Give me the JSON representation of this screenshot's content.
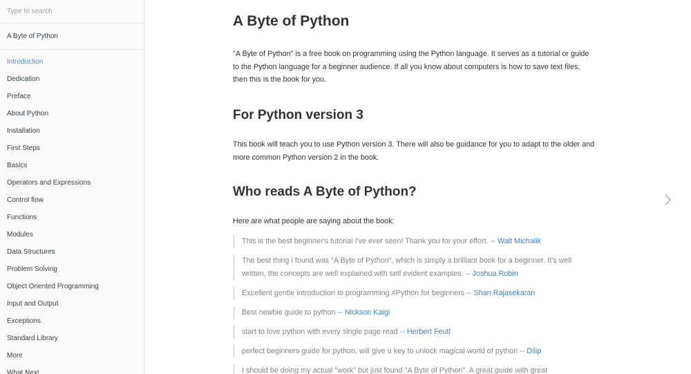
{
  "sidebar": {
    "search_placeholder": "Type to search",
    "book_title": "A Byte of Python",
    "items": [
      {
        "label": "Introduction",
        "active": true
      },
      {
        "label": "Dedication"
      },
      {
        "label": "Preface"
      },
      {
        "label": "About Python"
      },
      {
        "label": "Installation"
      },
      {
        "label": "First Steps"
      },
      {
        "label": "Basics"
      },
      {
        "label": "Operators and Expressions"
      },
      {
        "label": "Control flow"
      },
      {
        "label": "Functions"
      },
      {
        "label": "Modules"
      },
      {
        "label": "Data Structures"
      },
      {
        "label": "Problem Solving"
      },
      {
        "label": "Object Oriented Programming"
      },
      {
        "label": "Input and Output"
      },
      {
        "label": "Exceptions"
      },
      {
        "label": "Standard Library"
      },
      {
        "label": "More"
      },
      {
        "label": "What Next"
      }
    ]
  },
  "main": {
    "title": "A Byte of Python",
    "intro": "\"A Byte of Python\" is a free book on programming using the Python language. It serves as a tutorial or guide to the Python language for a beginner audience. If all you know about computers is how to save text files, then this is the book for you.",
    "section1": {
      "heading": "For Python version 3",
      "text": "This book will teach you to use Python version 3. There will also be guidance for you to adapt to the older and more common Python version 2 in the book."
    },
    "section2": {
      "heading": "Who reads A Byte of Python?",
      "text": "Here are what people are saying about the book:"
    },
    "quotes": [
      {
        "text": "This is the best beginner's tutorial I've ever seen! Thank you for your effort. -- ",
        "author": "Walt Michalik"
      },
      {
        "text": "The best thing i found was \"A Byte of Python\", which is simply a brilliant book for a beginner. It's well written, the concepts are well explained with self evident examples. -- ",
        "author": "Joshua Robin"
      },
      {
        "text": "Excellent gentle introduction to programming #Python for beginners -- ",
        "author": "Shan Rajasekaran"
      },
      {
        "text": "Best newbie guide to python -- ",
        "author": "Nickson Kaigi"
      },
      {
        "text": "start to love python with every single page read -- ",
        "author": "Herbert Feutl"
      },
      {
        "text": "perfect beginners guide for python, will give u key to unlock magical world of python -- ",
        "author": "Dilip"
      },
      {
        "text": "I should be doing my actual \"work\" but just found \"A Byte of Python\". A great guide with great",
        "author": ""
      }
    ]
  },
  "icons": {
    "next": "chevron-right-icon"
  },
  "colors": {
    "accent": "#3d8fd8",
    "link": "#4183c4",
    "text": "#333333",
    "quote_text": "#858585",
    "sidebar_bg": "#fafafa"
  }
}
